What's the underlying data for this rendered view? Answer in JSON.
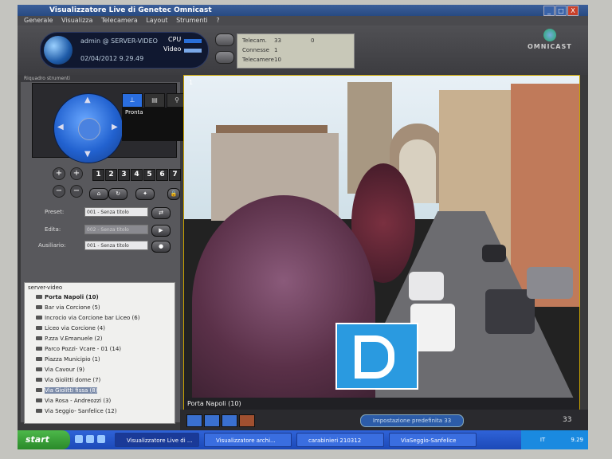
{
  "window": {
    "title": "Visualizzatore Live di Genetec Omnicast",
    "minimize": "_",
    "maximize": "□",
    "close": "X"
  },
  "menu": [
    "Generale",
    "Visualizza",
    "Telecamera",
    "Layout",
    "Strumenti",
    "?"
  ],
  "user": {
    "name": "admin @ SERVER-VIDEO",
    "datetime": "02/04/2012 9.29.49",
    "cpu_label": "CPU",
    "video_label": "Video"
  },
  "stats": {
    "rows": [
      {
        "label": "Telecam.",
        "value": "33",
        "extra": "0"
      },
      {
        "label": "Connesse",
        "value": "1",
        "extra": ""
      },
      {
        "label": "Telecamere",
        "value": "10",
        "extra": ""
      }
    ]
  },
  "logo": "OMNICAST",
  "panel": {
    "title": "Riquadro strumenti",
    "status": "Pronta",
    "preset_numbers": [
      "1",
      "2",
      "3",
      "4",
      "5",
      "6",
      "7"
    ],
    "preset_label": "Preset:",
    "preset_value": "001 - Senza titolo",
    "edit_label": "Edita:",
    "edit_value": "002 - Senza titolo",
    "aux_label": "Ausiliario:",
    "aux_value": "001 - Senza titolo"
  },
  "tree": {
    "root": "server-video",
    "items": [
      {
        "label": "Porta Napoli (10)",
        "bold": true
      },
      {
        "label": "Bar via Corcione (5)"
      },
      {
        "label": "Incrocio via Corcione bar Liceo (6)"
      },
      {
        "label": "Liceo via Corcione (4)"
      },
      {
        "label": "P.zza V.Emanuele (2)"
      },
      {
        "label": "Parco Pozzi- Vcare - 01 (14)"
      },
      {
        "label": "Piazza Municipio (1)"
      },
      {
        "label": "Via Cavour (9)"
      },
      {
        "label": "Via Giolitti dome (7)"
      },
      {
        "label": "Via Giolitti fissa (8)",
        "selected": true
      },
      {
        "label": "Via Rosa - Andreozzi (3)"
      },
      {
        "label": "Via Seggio- Sanfelice (12)"
      }
    ]
  },
  "video": {
    "tile_number": "1",
    "caption": "Porta Napoli (10)"
  },
  "bottom": {
    "saved_layout": "Impostazione predefinita 33",
    "count": "33"
  },
  "taskbar": {
    "start": "start",
    "tasks": [
      {
        "label": "Visualizzatore Live di ...",
        "active": true
      },
      {
        "label": "Visualizzatore archi..."
      },
      {
        "label": "carabinieri 210312"
      },
      {
        "label": "ViaSeggio-Sanfelice"
      }
    ],
    "lang": "IT",
    "clock": "9.29"
  }
}
